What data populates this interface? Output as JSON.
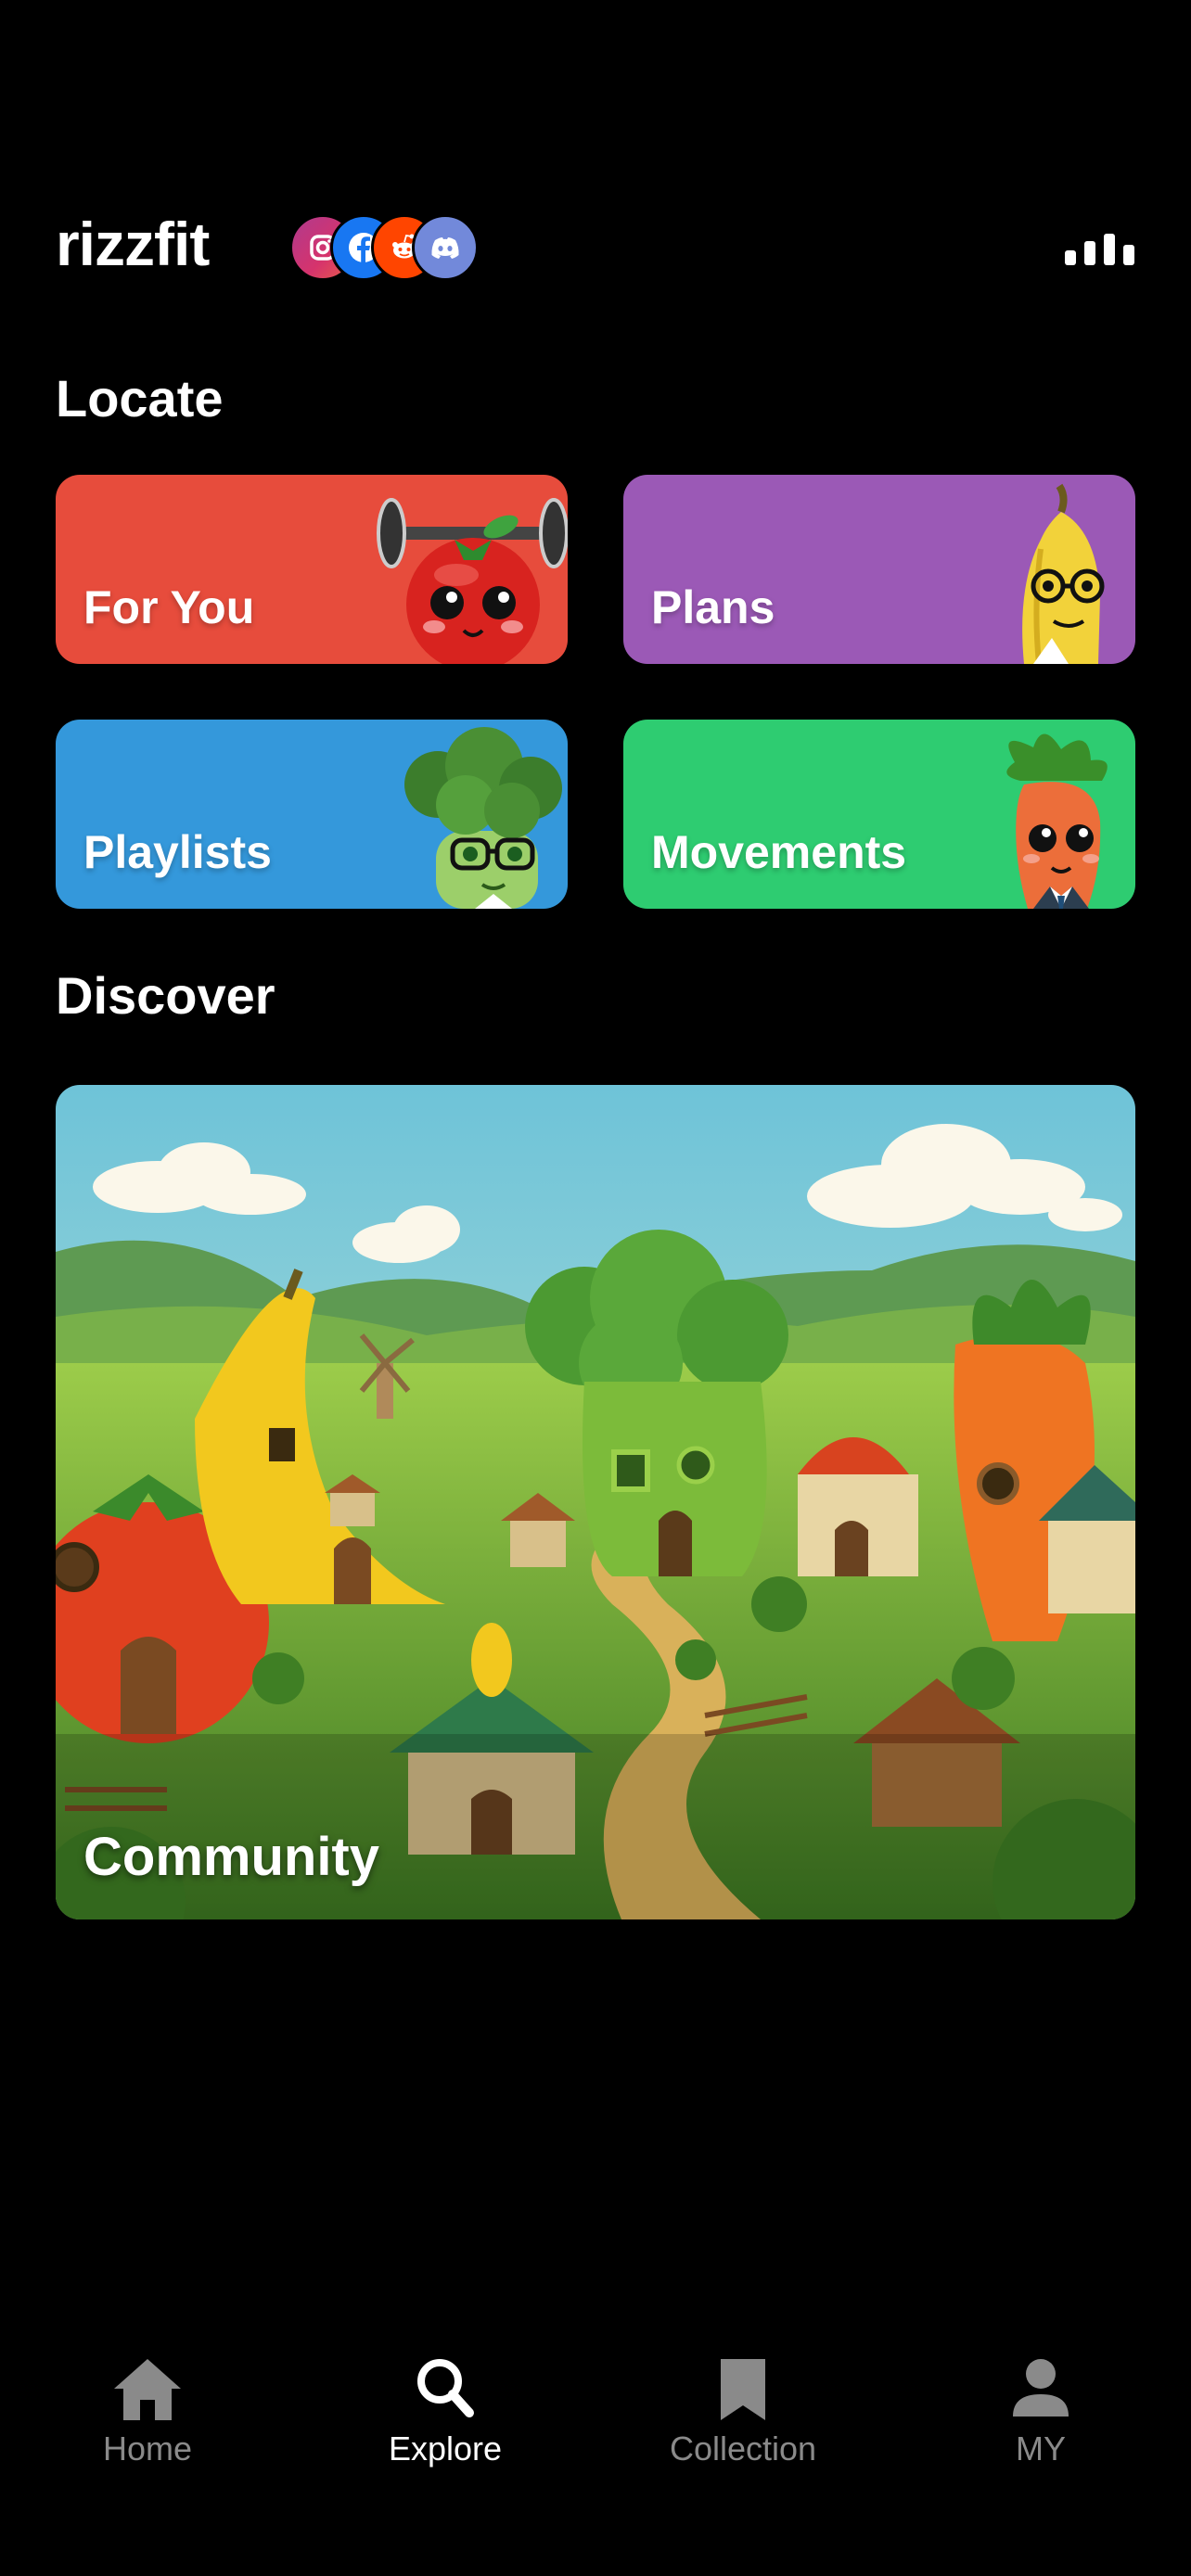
{
  "header": {
    "logo": "rizzfit",
    "socials": [
      {
        "name": "instagram-icon",
        "color": "#d6336c"
      },
      {
        "name": "facebook-icon",
        "color": "#1877f2"
      },
      {
        "name": "reddit-icon",
        "color": "#ff4500"
      },
      {
        "name": "discord-icon",
        "color": "#7289da"
      }
    ],
    "menu_icon": "audio-bars-icon"
  },
  "locate": {
    "title": "Locate",
    "cards": [
      {
        "label": "For You",
        "color": "#e74c3c",
        "mascot": "tomato-weightlifter"
      },
      {
        "label": "Plans",
        "color": "#9b59b6",
        "mascot": "banana-with-glasses"
      },
      {
        "label": "Playlists",
        "color": "#3498db",
        "mascot": "broccoli-with-glasses"
      },
      {
        "label": "Movements",
        "color": "#2ecc71",
        "mascot": "carrot-in-suit"
      }
    ]
  },
  "discover": {
    "title": "Discover",
    "feature_label": "Community"
  },
  "nav": {
    "items": [
      {
        "label": "Home",
        "icon": "home-icon",
        "active": false
      },
      {
        "label": "Explore",
        "icon": "search-icon",
        "active": true
      },
      {
        "label": "Collection",
        "icon": "bookmark-icon",
        "active": false
      },
      {
        "label": "MY",
        "icon": "person-icon",
        "active": false
      }
    ]
  }
}
